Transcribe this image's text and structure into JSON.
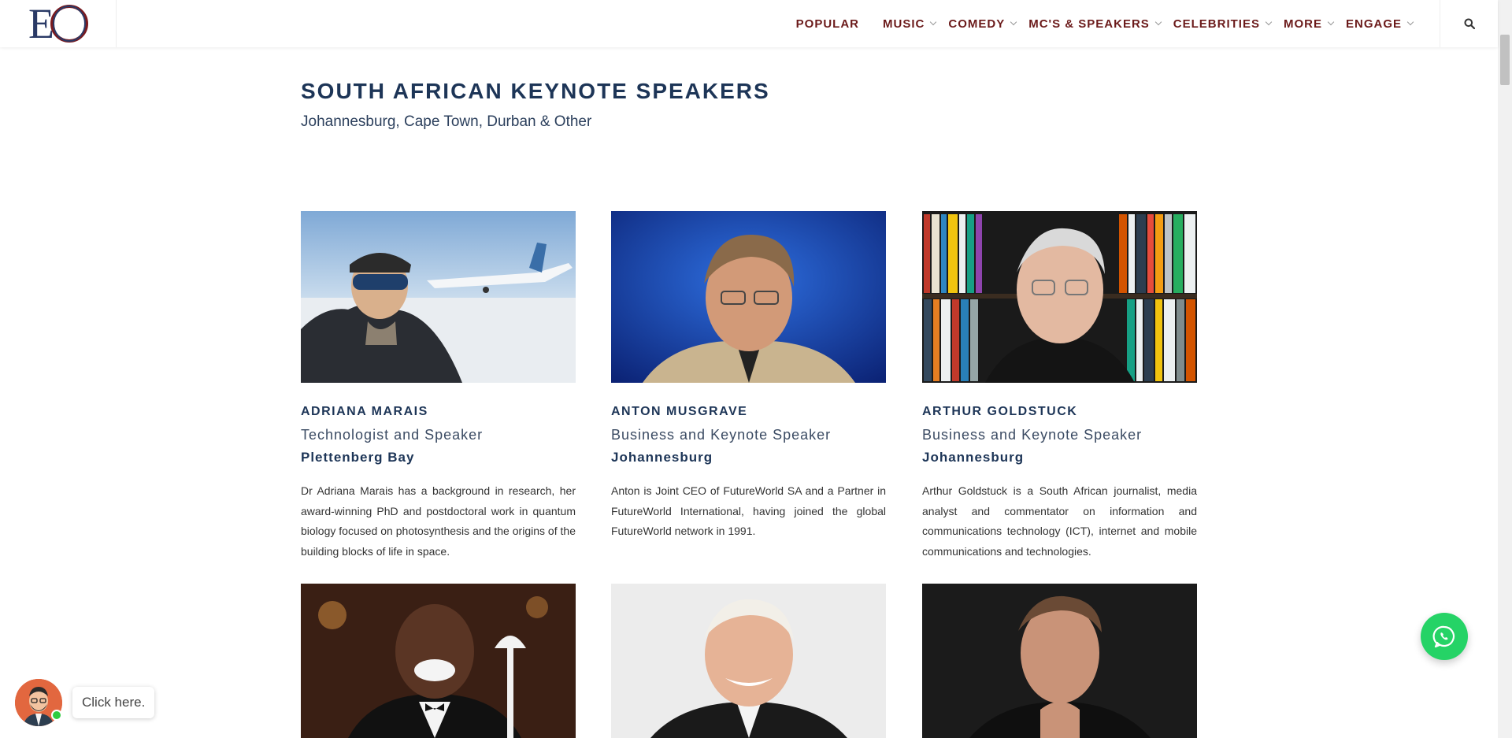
{
  "header": {
    "logo_text": "EO",
    "nav": [
      {
        "label": "POPULAR",
        "dropdown": false
      },
      {
        "label": "MUSIC",
        "dropdown": true
      },
      {
        "label": "COMEDY",
        "dropdown": true
      },
      {
        "label": "MC'S & SPEAKERS",
        "dropdown": true
      },
      {
        "label": "CELEBRITIES",
        "dropdown": true
      },
      {
        "label": "MORE",
        "dropdown": true
      },
      {
        "label": "ENGAGE",
        "dropdown": true
      }
    ],
    "search_icon": "search-icon"
  },
  "page": {
    "title": "SOUTH AFRICAN KEYNOTE SPEAKERS",
    "subtitle": "Johannesburg, Cape Town, Durban & Other"
  },
  "speakers": [
    {
      "name": "ADRIANA MARAIS",
      "role": "Technologist and Speaker",
      "location": "Plettenberg Bay",
      "description": "Dr Adriana Marais has a background in research, her award-winning PhD and postdoctoral work in quantum biology focused on photosynthesis and the origins of the building blocks of life in space."
    },
    {
      "name": "ANTON MUSGRAVE",
      "role": "Business and Keynote Speaker",
      "location": "Johannesburg",
      "description": "Anton is Joint CEO of FutureWorld SA and a Partner in FutureWorld International, having joined the global FutureWorld network in 1991."
    },
    {
      "name": "ARTHUR GOLDSTUCK",
      "role": "Business and Keynote Speaker",
      "location": "Johannesburg",
      "description": "Arthur Goldstuck is a South African journalist, media analyst and commentator on information and communications technology (ICT), internet and mobile communications and technologies."
    }
  ],
  "chat": {
    "bubble_text": "Click here."
  },
  "colors": {
    "nav_text": "#6b1a1a",
    "heading": "#1d3557",
    "whatsapp": "#25d366",
    "chat_avatar": "#e2673f"
  }
}
